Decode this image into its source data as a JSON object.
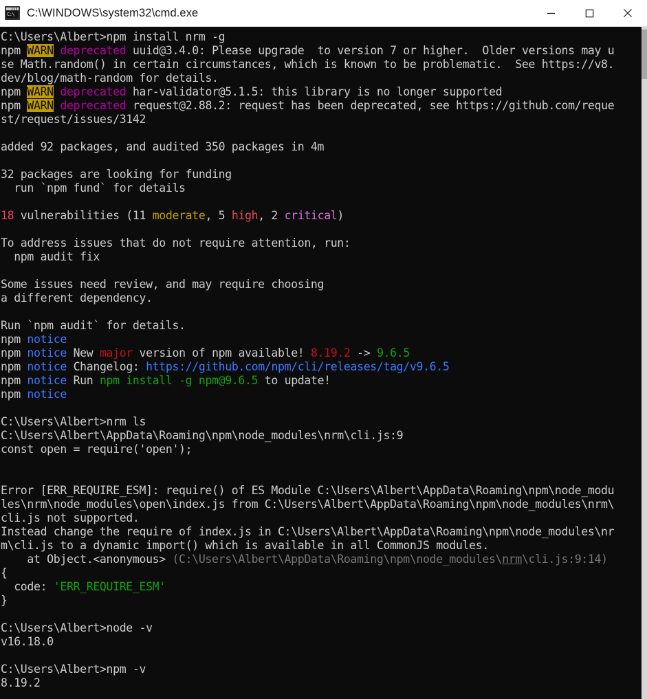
{
  "window": {
    "title": "C:\\WINDOWS\\system32\\cmd.exe",
    "icon": "cmd-icon",
    "icon_text": "C:\\",
    "background_color": "#0c0c0c",
    "titlebar_color": "#ffffff",
    "controls": [
      {
        "name": "minimize-button",
        "label": "Minimize"
      },
      {
        "name": "maximize-button",
        "label": "Maximize"
      },
      {
        "name": "close-button",
        "label": "Close"
      }
    ]
  },
  "colors": {
    "terminal_bg": "#0c0c0c",
    "default_text": "#cccccc",
    "warn_badge_bg": "#c19c00",
    "warn_badge_fg": "#0c0c0c",
    "deprecated": "#b4009e",
    "notice": "#3b78ff",
    "error_red": "#e74856",
    "success_green": "#13a10e",
    "dim_gray": "#767676",
    "scrollbar_track": "#d6d6d6",
    "scrollbar_thumb": "#a7a7a7"
  },
  "scrollbar": {
    "name": "vertical-scrollbar",
    "thumb_name": "scrollbar-thumb"
  },
  "terminal": {
    "prompt": "C:\\Users\\Albert>",
    "lines": [
      {
        "id": "l01",
        "segments": [
          {
            "t": "C:\\Users\\Albert>npm install nrm -g",
            "c": "c-default"
          }
        ]
      },
      {
        "id": "l02",
        "segments": [
          {
            "t": "npm ",
            "c": "c-default"
          },
          {
            "t": "WARN",
            "c": "c-badge-warn"
          },
          {
            "t": " ",
            "c": "c-default"
          },
          {
            "t": "deprecated",
            "c": "c-magenta"
          },
          {
            "t": " uuid@3.4.0: Please upgrade  to version 7 or higher.  Older versions may u",
            "c": "c-default"
          }
        ]
      },
      {
        "id": "l03",
        "segments": [
          {
            "t": "se Math.random() in certain circumstances, which is known to be problematic.  See https://v8.",
            "c": "c-default"
          }
        ]
      },
      {
        "id": "l04",
        "segments": [
          {
            "t": "dev/blog/math-random for details.",
            "c": "c-default"
          }
        ]
      },
      {
        "id": "l05",
        "segments": [
          {
            "t": "npm ",
            "c": "c-default"
          },
          {
            "t": "WARN",
            "c": "c-badge-warn"
          },
          {
            "t": " ",
            "c": "c-default"
          },
          {
            "t": "deprecated",
            "c": "c-magenta"
          },
          {
            "t": " har-validator@5.1.5: this library is no longer supported",
            "c": "c-default"
          }
        ]
      },
      {
        "id": "l06",
        "segments": [
          {
            "t": "npm ",
            "c": "c-default"
          },
          {
            "t": "WARN",
            "c": "c-badge-warn"
          },
          {
            "t": " ",
            "c": "c-default"
          },
          {
            "t": "deprecated",
            "c": "c-magenta"
          },
          {
            "t": " request@2.88.2: request has been deprecated, see https://github.com/reque",
            "c": "c-default"
          }
        ]
      },
      {
        "id": "l07",
        "segments": [
          {
            "t": "st/request/issues/3142",
            "c": "c-default"
          }
        ]
      },
      {
        "id": "l08",
        "segments": [
          {
            "t": " ",
            "c": "c-default"
          }
        ]
      },
      {
        "id": "l09",
        "segments": [
          {
            "t": "added 92 packages, and audited 350 packages in 4m",
            "c": "c-default"
          }
        ]
      },
      {
        "id": "l10",
        "segments": [
          {
            "t": " ",
            "c": "c-default"
          }
        ]
      },
      {
        "id": "l11",
        "segments": [
          {
            "t": "32 packages are looking for funding",
            "c": "c-default"
          }
        ]
      },
      {
        "id": "l12",
        "segments": [
          {
            "t": "  run `npm fund` for details",
            "c": "c-default"
          }
        ]
      },
      {
        "id": "l13",
        "segments": [
          {
            "t": " ",
            "c": "c-default"
          }
        ]
      },
      {
        "id": "l14",
        "segments": [
          {
            "t": "18",
            "c": "c-red"
          },
          {
            "t": " vulnerabilities (11 ",
            "c": "c-default"
          },
          {
            "t": "moderate",
            "c": "c-yellow"
          },
          {
            "t": ", 5 ",
            "c": "c-default"
          },
          {
            "t": "high",
            "c": "c-red"
          },
          {
            "t": ", 2 ",
            "c": "c-default"
          },
          {
            "t": "critical",
            "c": "c-brightmagenta"
          },
          {
            "t": ")",
            "c": "c-default"
          }
        ]
      },
      {
        "id": "l15",
        "segments": [
          {
            "t": " ",
            "c": "c-default"
          }
        ]
      },
      {
        "id": "l16",
        "segments": [
          {
            "t": "To address issues that do not require attention, run:",
            "c": "c-default"
          }
        ]
      },
      {
        "id": "l17",
        "segments": [
          {
            "t": "  npm audit fix",
            "c": "c-default"
          }
        ]
      },
      {
        "id": "l18",
        "segments": [
          {
            "t": " ",
            "c": "c-default"
          }
        ]
      },
      {
        "id": "l19",
        "segments": [
          {
            "t": "Some issues need review, and may require choosing",
            "c": "c-default"
          }
        ]
      },
      {
        "id": "l20",
        "segments": [
          {
            "t": "a different dependency.",
            "c": "c-default"
          }
        ]
      },
      {
        "id": "l21",
        "segments": [
          {
            "t": " ",
            "c": "c-default"
          }
        ]
      },
      {
        "id": "l22",
        "segments": [
          {
            "t": "Run `npm audit` for details.",
            "c": "c-default"
          }
        ]
      },
      {
        "id": "l23",
        "segments": [
          {
            "t": "npm ",
            "c": "c-default"
          },
          {
            "t": "notice",
            "c": "c-blue"
          }
        ]
      },
      {
        "id": "l24",
        "segments": [
          {
            "t": "npm ",
            "c": "c-default"
          },
          {
            "t": "notice",
            "c": "c-blue"
          },
          {
            "t": " New ",
            "c": "c-default"
          },
          {
            "t": "major",
            "c": "c-darkred"
          },
          {
            "t": " version of npm available! ",
            "c": "c-default"
          },
          {
            "t": "8.19.2",
            "c": "c-darkred"
          },
          {
            "t": " -> ",
            "c": "c-default"
          },
          {
            "t": "9.6.5",
            "c": "c-darkgreen"
          }
        ]
      },
      {
        "id": "l25",
        "segments": [
          {
            "t": "npm ",
            "c": "c-default"
          },
          {
            "t": "notice",
            "c": "c-blue"
          },
          {
            "t": " Changelog: ",
            "c": "c-default"
          },
          {
            "t": "https://github.com/npm/cli/releases/tag/v9.6.5",
            "c": "c-blue"
          }
        ]
      },
      {
        "id": "l26",
        "segments": [
          {
            "t": "npm ",
            "c": "c-default"
          },
          {
            "t": "notice",
            "c": "c-blue"
          },
          {
            "t": " Run ",
            "c": "c-default"
          },
          {
            "t": "npm install -g npm@9.6.5",
            "c": "c-darkgreen"
          },
          {
            "t": " to update!",
            "c": "c-default"
          }
        ]
      },
      {
        "id": "l27",
        "segments": [
          {
            "t": "npm ",
            "c": "c-default"
          },
          {
            "t": "notice",
            "c": "c-blue"
          }
        ]
      },
      {
        "id": "l28",
        "segments": [
          {
            "t": " ",
            "c": "c-default"
          }
        ]
      },
      {
        "id": "l29",
        "segments": [
          {
            "t": "C:\\Users\\Albert>nrm ls",
            "c": "c-default"
          }
        ]
      },
      {
        "id": "l30",
        "segments": [
          {
            "t": "C:\\Users\\Albert\\AppData\\Roaming\\npm\\node_modules\\nrm\\cli.js:9",
            "c": "c-default"
          }
        ]
      },
      {
        "id": "l31",
        "segments": [
          {
            "t": "const open = require('open');",
            "c": "c-default"
          }
        ]
      },
      {
        "id": "l32",
        "segments": [
          {
            "t": " ",
            "c": "c-default"
          }
        ]
      },
      {
        "id": "l33",
        "segments": [
          {
            "t": " ",
            "c": "c-default"
          }
        ]
      },
      {
        "id": "l34",
        "segments": [
          {
            "t": "Error [ERR_REQUIRE_ESM]: require() of ES Module C:\\Users\\Albert\\AppData\\Roaming\\npm\\node_modu",
            "c": "c-default"
          }
        ]
      },
      {
        "id": "l35",
        "segments": [
          {
            "t": "les\\nrm\\node_modules\\open\\index.js from C:\\Users\\Albert\\AppData\\Roaming\\npm\\node_modules\\nrm\\",
            "c": "c-default"
          }
        ]
      },
      {
        "id": "l36",
        "segments": [
          {
            "t": "cli.js not supported.",
            "c": "c-default"
          }
        ]
      },
      {
        "id": "l37",
        "segments": [
          {
            "t": "Instead change the require of index.js in C:\\Users\\Albert\\AppData\\Roaming\\npm\\node_modules\\nr",
            "c": "c-default"
          }
        ]
      },
      {
        "id": "l38",
        "segments": [
          {
            "t": "m\\cli.js to a dynamic import() which is available in all CommonJS modules.",
            "c": "c-default"
          }
        ]
      },
      {
        "id": "l39",
        "segments": [
          {
            "t": "    at Object.<anonymous> ",
            "c": "c-default"
          },
          {
            "t": "(C:\\Users\\Albert\\AppData\\Roaming\\npm\\node_modules\\",
            "c": "c-gray"
          },
          {
            "t": "nrm",
            "c": "c-gray underline"
          },
          {
            "t": "\\cli.js:9:14)",
            "c": "c-gray"
          }
        ]
      },
      {
        "id": "l40",
        "segments": [
          {
            "t": "{",
            "c": "c-default"
          }
        ]
      },
      {
        "id": "l41",
        "segments": [
          {
            "t": "  code: ",
            "c": "c-default"
          },
          {
            "t": "'ERR_REQUIRE_ESM'",
            "c": "c-darkgreen"
          }
        ]
      },
      {
        "id": "l42",
        "segments": [
          {
            "t": "}",
            "c": "c-default"
          }
        ]
      },
      {
        "id": "l43",
        "segments": [
          {
            "t": " ",
            "c": "c-default"
          }
        ]
      },
      {
        "id": "l44",
        "segments": [
          {
            "t": "C:\\Users\\Albert>node -v",
            "c": "c-default"
          }
        ]
      },
      {
        "id": "l45",
        "segments": [
          {
            "t": "v16.18.0",
            "c": "c-default"
          }
        ]
      },
      {
        "id": "l46",
        "segments": [
          {
            "t": " ",
            "c": "c-default"
          }
        ]
      },
      {
        "id": "l47",
        "segments": [
          {
            "t": "C:\\Users\\Albert>npm -v",
            "c": "c-default"
          }
        ]
      },
      {
        "id": "l48",
        "segments": [
          {
            "t": "8.19.2",
            "c": "c-default"
          }
        ]
      }
    ]
  }
}
